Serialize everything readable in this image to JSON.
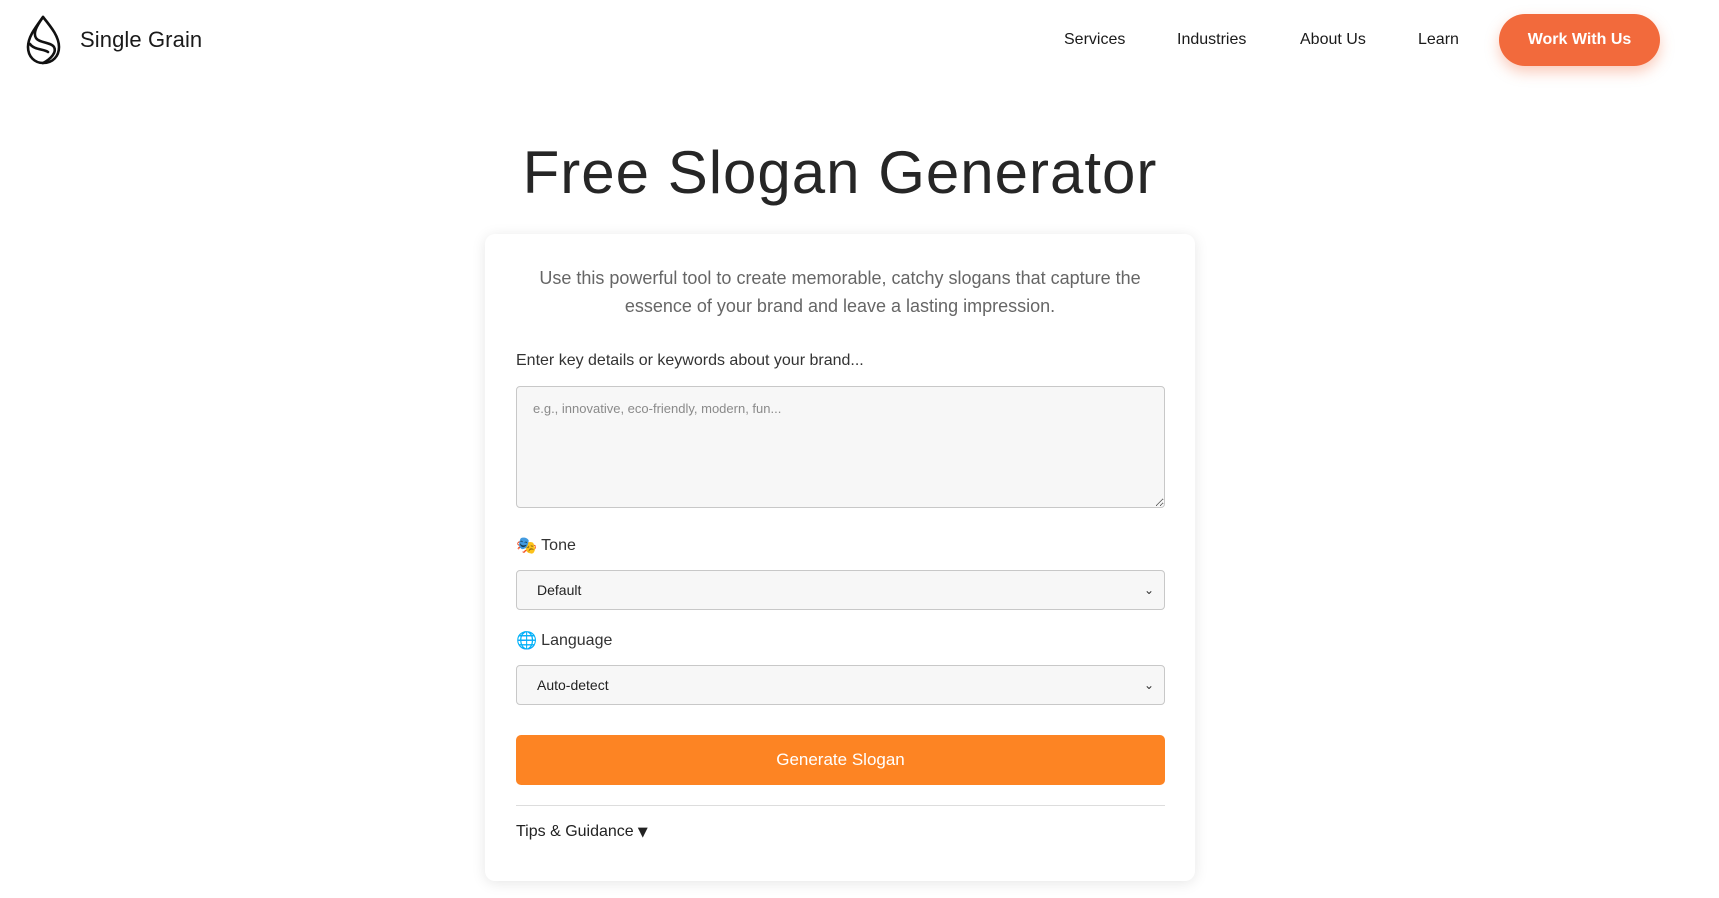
{
  "header": {
    "brand": "Single Grain",
    "nav": [
      "Services",
      "Industries",
      "About Us",
      "Learn"
    ],
    "cta": "Work With Us"
  },
  "main": {
    "title": "Free Slogan Generator",
    "intro": "Use this powerful tool to create memorable, catchy slogans that capture the essence of your brand and leave a lasting impression.",
    "keywords_label": "Enter key details or keywords about your brand...",
    "keywords_placeholder": "e.g., innovative, eco-friendly, modern, fun...",
    "keywords_value": "",
    "tone": {
      "icon": "🎭",
      "label": "Tone",
      "value": "Default"
    },
    "language": {
      "icon": "🌐",
      "label": "Language",
      "value": "Auto-detect"
    },
    "generate_label": "Generate Slogan",
    "tips_label": "Tips & Guidance",
    "tips_caret": "▼"
  },
  "colors": {
    "cta": "#f26a3c",
    "generate": "#fd8423",
    "text": "#262626"
  },
  "icons": {
    "logo": "single-grain-drop-logo",
    "select_caret": "chevron-down-icon",
    "tips_caret": "triangle-down-icon"
  }
}
